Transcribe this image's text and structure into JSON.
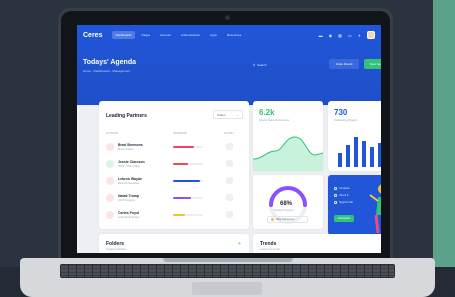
{
  "app": {
    "brand": "Ceres",
    "nav": [
      "Dashboards",
      "Pages",
      "Account",
      "Authentication",
      "Apps",
      "Resources"
    ],
    "active_nav": "Dashboards"
  },
  "header": {
    "title": "Todays' Agenda",
    "breadcrumb": "Home  -  Dashboards  -  Management",
    "search_label": "Search",
    "invite_label": "Invite Friend",
    "new_label": "New Goal"
  },
  "partners": {
    "title": "Leading Partners",
    "filter": "Status",
    "columns": [
      "AUTHORS",
      "PROGRESS",
      "ACTION"
    ],
    "rows": [
      {
        "name": "Brad Simmons",
        "sub": "Movie Creator",
        "progress": 0.7,
        "color": "#f1416c"
      },
      {
        "name": "Jessie Clarcson",
        "sub": "HTML, CSS Coding",
        "progress": 0.5,
        "color": "#e94c4c"
      },
      {
        "name": "Lebron Wayde",
        "sub": "ReactJS Developer",
        "progress": 0.9,
        "color": "#2156d9"
      },
      {
        "name": "Natali Trump",
        "sub": "UI/UX Designer",
        "progress": 0.6,
        "color": "#8950fc"
      },
      {
        "name": "Carles Puyol",
        "sub": "Lead Studio Expert",
        "progress": 0.4,
        "color": "#f0c23b"
      }
    ]
  },
  "stats": {
    "left": {
      "value": "6.2k",
      "label": "Weekly Sales Performance"
    },
    "right": {
      "value": "730",
      "label": "Outstanding Projects"
    }
  },
  "gauge": {
    "value": "68%",
    "label": "Monthly Progress",
    "pill": "Daily Milestones"
  },
  "checklist": {
    "items": [
      "Complete",
      "Check In",
      "Support Call"
    ],
    "button": "Get Report"
  },
  "folders": {
    "title": "Folders",
    "sub": "Ongoing Activities"
  },
  "trends": {
    "title": "Trends",
    "sub": "Latest tech trends"
  }
}
